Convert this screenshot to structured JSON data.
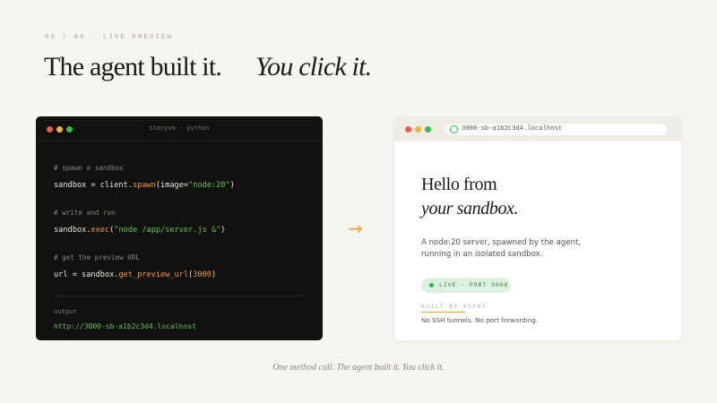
{
  "slide": {
    "eyebrow": "05 / 09 · LIVE PREVIEW",
    "headline_plain": "The agent built it.",
    "headline_italic": "You click it.",
    "caption": "One method call. The agent built it. You click it."
  },
  "terminal": {
    "title": "stacyvm · python",
    "comments": [
      "# spawn a sandbox",
      "# write and run",
      "# get the preview URL"
    ],
    "line1": {
      "lhs": "sandbox = client.",
      "method": "spawn",
      "open": "(image=",
      "arg": "\"node:20\"",
      "close": ")"
    },
    "line2": {
      "lhs": "sandbox.",
      "method": "exec",
      "open": "(",
      "arg": "\"node /app/server.js &\"",
      "close": ")"
    },
    "line3": {
      "lhs": "url = sandbox.",
      "method": "get_preview_url",
      "open": "(",
      "arg": "3000",
      "close": ")"
    },
    "output_label": "output",
    "output_url": "http://3000-sb-a1b2c3d4.localhost"
  },
  "arrow": "→",
  "browser": {
    "url": "3000-sb-a1b2c3d4.localhost",
    "heading_line1": "Hello from",
    "heading_line2": "your sandbox.",
    "description": "A node:20 server, spawned by the agent, running in an isolated sandbox.",
    "status_badge": "LIVE · PORT 3000",
    "built_label": "BUILT BY AGENT",
    "built_note": "No SSH tunnels. No port forwarding."
  },
  "colors": {
    "background": "#f6f4ef",
    "terminal_bg": "#111110",
    "accent_orange": "#f0973a",
    "string_green": "#6cc25a",
    "live_badge_bg": "#dcf1df"
  },
  "icons": [
    "close-dot-icon",
    "minimize-dot-icon",
    "maximize-dot-icon",
    "secure-lock-icon",
    "right-arrow-icon",
    "live-status-dot-icon"
  ]
}
